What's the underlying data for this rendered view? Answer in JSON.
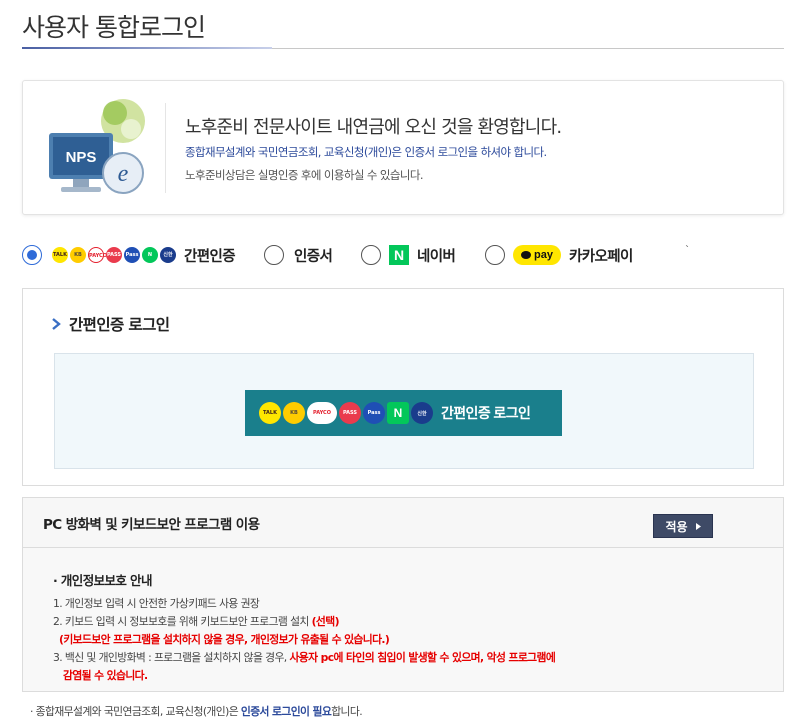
{
  "page": {
    "title": "사용자 통합로그인"
  },
  "welcome": {
    "logo_text": "NPS",
    "heading": "노후준비 전문사이트 내연금에 오신 것을 환영합니다.",
    "line2": "종합재무설계와 국민연금조회, 교육신청(개인)은 인증서 로그인을 하셔야 합니다.",
    "line3": "노후준비상담은 실명인증 후에 이용하실 수 있습니다."
  },
  "login_methods": [
    {
      "label": "간편인증",
      "selected": true
    },
    {
      "label": "인증서",
      "selected": false
    },
    {
      "label": "네이버",
      "selected": false,
      "icon_text": "N"
    },
    {
      "label": "카카오페이",
      "selected": false,
      "icon_text": "pay"
    }
  ],
  "stray_mark": "`",
  "easy_login": {
    "heading": "간편인증 로그인",
    "button_label": "간편인증 로그인",
    "provider_icons": [
      {
        "name": "kakaotalk",
        "text": "TALK",
        "color": "#ffe600",
        "fg": "#3a1d1d"
      },
      {
        "name": "kb",
        "text": "KB",
        "color": "#ffcc00",
        "fg": "#54493a"
      },
      {
        "name": "payco",
        "text": "PAYCO",
        "color": "#ffffff",
        "fg": "#e4202e"
      },
      {
        "name": "pass",
        "text": "PASS",
        "color": "#ea3b4d",
        "fg": "#ffffff"
      },
      {
        "name": "samsung-pass",
        "text": "Pass",
        "color": "#1f4fb5",
        "fg": "#ffffff"
      },
      {
        "name": "naver",
        "text": "N",
        "color": "#03c75a",
        "fg": "#ffffff"
      },
      {
        "name": "shinhan",
        "text": "신한",
        "color": "#1a3c8c",
        "fg": "#ffffff"
      }
    ]
  },
  "security": {
    "title": "PC 방화벽 및 키보드보안 프로그램 이용",
    "apply_label": "적용",
    "privacy_heading": "· 개인정보보호 안내",
    "item1": "1. 개인정보 입력 시 안전한 가상키패드 사용 권장",
    "item2_prefix": "2. 키보드 입력 시 정보보호를 위해 키보드보안 프로그램 설치 ",
    "item2_red": "(선택)",
    "item2_note": "(키보드보안 프로그램을 설치하지 않을 경우, 개인정보가 유출될 수 있습니다.)",
    "item3_prefix": "3. 백신 및 개인방화벽 : 프로그램을 설치하지 않을 경우, ",
    "item3_red": "사용자 pc에 타인의 침입이 발생할 수 있으며, 악성 프로그램에",
    "item3_red2": "감염될 수 있습니다."
  },
  "footer": {
    "prefix": "· 종합재무설계와 국민연금조회, 교육신청(개인)은 ",
    "highlight": "인증서 로그인이 필요",
    "suffix": "합니다."
  },
  "colors": {
    "accent": "#2f6bd8",
    "button_teal": "#1a7f8c",
    "apply_navy": "#3e4a66",
    "warning_red": "#e60000",
    "link_blue": "#2c4a9b"
  }
}
